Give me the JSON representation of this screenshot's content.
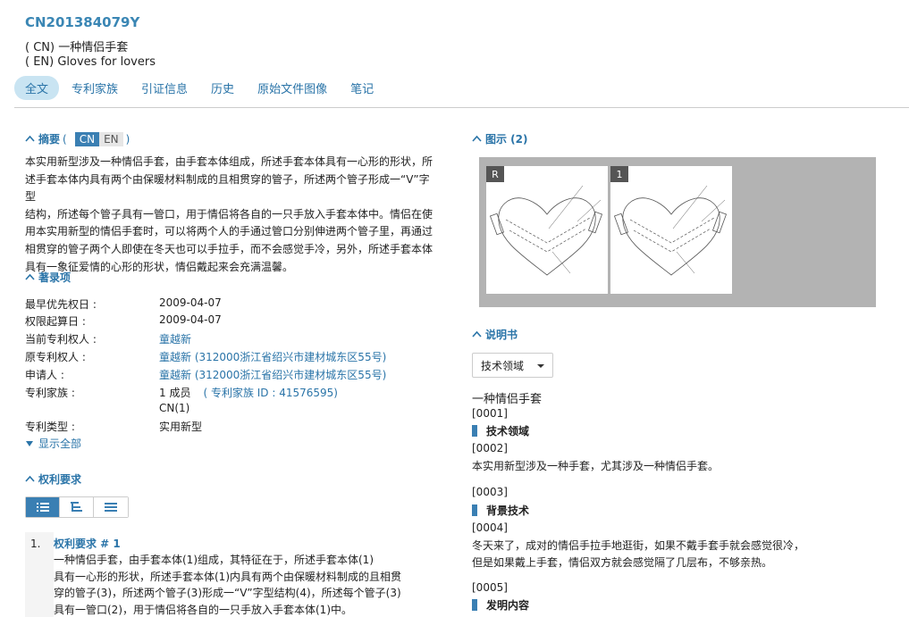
{
  "header": {
    "pub_number": "CN201384079Y",
    "title_cn": "( CN) 一种情侣手套",
    "title_en": "( EN) Gloves for lovers"
  },
  "tabs": [
    {
      "label": "全文",
      "active": true
    },
    {
      "label": "专利家族"
    },
    {
      "label": "引证信息"
    },
    {
      "label": "历史"
    },
    {
      "label": "原始文件图像"
    },
    {
      "label": "笔记"
    }
  ],
  "abstract": {
    "heading": "摘要",
    "lang_open": "(",
    "lang_cn": "CN",
    "lang_en": "EN",
    "lang_close": ")",
    "lines": [
      "本实用新型涉及一种情侣手套，由手套本体组成，所述手套本体具有一心形的形状，所",
      "述手套本体内具有两个由保暖材料制成的且相贯穿的管子，所述两个管子形成一“V”字型",
      "结构，所述每个管子具有一管口，用于情侣将各自的一只手放入手套本体中。情侣在使",
      "用本实用新型的情侣手套时，可以将两个人的手通过管口分别伸进两个管子里，再通过",
      "相贯穿的管子两个人即使在冬天也可以手拉手，而不会感觉手冷，另外，所述手套本体",
      "具有一象征爱情的心形的形状，情侣戴起来会充满温馨。"
    ]
  },
  "biblio": {
    "heading": "著录项",
    "rows": [
      {
        "label": "最早优先权日 :",
        "value": "2009-04-07"
      },
      {
        "label": "权限起算日 :",
        "value": "2009-04-07"
      },
      {
        "label": "当前专利权人 :",
        "value": "童越新"
      },
      {
        "label": "原专利权人 :",
        "value": "童越新 (312000浙江省绍兴市建材城东区55号)"
      },
      {
        "label": "申请人 :",
        "value": "童越新 (312000浙江省绍兴市建材城东区55号)"
      },
      {
        "label": "专利家族 :",
        "value": "1 成员",
        "extra": "( 专利家族 ID : 41576595)"
      },
      {
        "label": "",
        "value": "CN(1)"
      },
      {
        "label": "专利类型 :",
        "value": "实用新型"
      }
    ],
    "show_all": "显示全部"
  },
  "claims": {
    "heading": "权利要求",
    "num": "1.",
    "title": "权利要求 # 1",
    "lines": [
      "一种情侣手套，由手套本体(1)组成，其特征在于，所述手套本体(1)",
      "具有一心形的形状，所述手套本体(1)内具有两个由保暖材料制成的且相贯",
      "穿的管子(3)，所述两个管子(3)形成一“V”字型结构(4)，所述每个管子(3)",
      "具有一管口(2)，用于情侣将各自的一只手放入手套本体(1)中。"
    ]
  },
  "figures": {
    "heading": "图示 (2)",
    "items": [
      {
        "tag": "R"
      },
      {
        "tag": "1"
      }
    ]
  },
  "description": {
    "heading": "说明书",
    "select_value": "技术领域",
    "title": "一种情侣手套",
    "p0001": "[0001]",
    "h1": "技术领域",
    "p0002": "[0002]",
    "t0002": "本实用新型涉及一种手套，尤其涉及一种情侣手套。",
    "p0003": "[0003]",
    "h2": "背景技术",
    "p0004": "[0004]",
    "t0004a": "冬天来了，成对的情侣手拉手地逛街，如果不戴手套手就会感觉很冷，",
    "t0004b": "但是如果戴上手套，情侣双方就会感觉隔了几层布，不够亲热。",
    "p0005": "[0005]",
    "h3": "发明内容"
  },
  "colors": {
    "accent": "#2a74a8",
    "active_tab": "#c9e4f2",
    "toggle_on": "#3a7fb3"
  }
}
